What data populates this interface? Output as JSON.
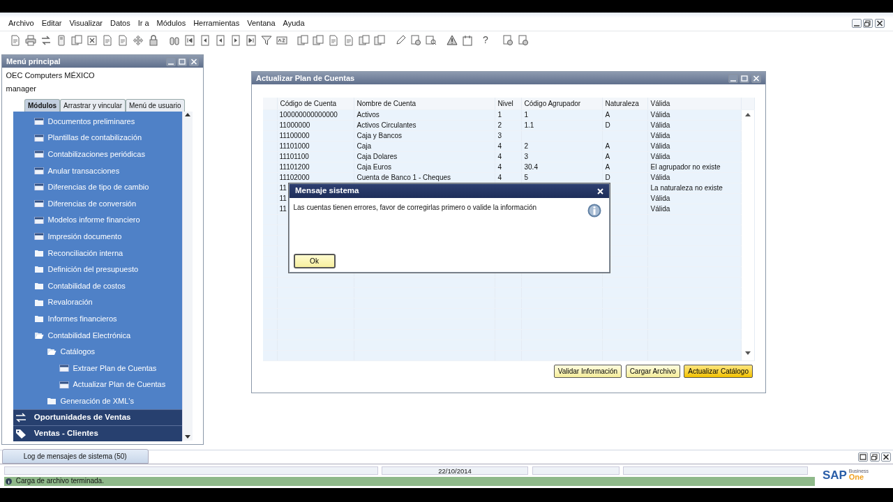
{
  "menu_bar": [
    "Archivo",
    "Editar",
    "Visualizar",
    "Datos",
    "Ir a",
    "Módulos",
    "Herramientas",
    "Ventana",
    "Ayuda"
  ],
  "toolbar": {
    "help_label": "?"
  },
  "main_menu": {
    "title": "Menú principal",
    "company": "OEC Computers MÉXICO",
    "user": "manager",
    "tabs": [
      {
        "label": "Módulos",
        "selected": true
      },
      {
        "label": "Arrastrar y vincular",
        "selected": false
      },
      {
        "label": "Menú de usuario",
        "selected": false
      }
    ],
    "items": [
      {
        "label": "Documentos preliminares",
        "kind": "form"
      },
      {
        "label": "Plantillas de contabilización",
        "kind": "form"
      },
      {
        "label": "Contabilizaciones periódicas",
        "kind": "form"
      },
      {
        "label": "Anular transacciones",
        "kind": "form"
      },
      {
        "label": "Diferencias de tipo de cambio",
        "kind": "form"
      },
      {
        "label": "Diferencias de conversión",
        "kind": "form"
      },
      {
        "label": "Modelos informe financiero",
        "kind": "form"
      },
      {
        "label": "Impresión documento",
        "kind": "form"
      },
      {
        "label": "Reconciliación interna",
        "kind": "folder",
        "expanded": false
      },
      {
        "label": "Definición del presupuesto",
        "kind": "folder",
        "expanded": false
      },
      {
        "label": "Contabilidad de costos",
        "kind": "folder",
        "expanded": false
      },
      {
        "label": "Revaloración",
        "kind": "folder",
        "expanded": false
      },
      {
        "label": "Informes financieros",
        "kind": "folder",
        "expanded": false
      },
      {
        "label": "Contabilidad Electrónica",
        "kind": "folder",
        "expanded": true,
        "children": [
          {
            "label": "Catálogos",
            "kind": "folder",
            "expanded": true,
            "children": [
              {
                "label": "Extraer Plan de Cuentas",
                "kind": "form"
              },
              {
                "label": "Actualizar Plan de Cuentas",
                "kind": "form"
              }
            ]
          },
          {
            "label": "Generación de XML's",
            "kind": "folder",
            "expanded": false
          }
        ]
      }
    ],
    "modules": [
      {
        "label": "Oportunidades de Ventas",
        "kind": "opportunities"
      },
      {
        "label": "Ventas - Clientes",
        "kind": "sales"
      }
    ]
  },
  "window": {
    "title": "Actualizar Plan de Cuentas",
    "table": {
      "columns": [
        "Código de Cuenta",
        "Nombre de Cuenta",
        "Nivel",
        "Código Agrupador",
        "Naturaleza",
        "Válida"
      ],
      "rows": [
        [
          "100000000000000",
          "Activos",
          "1",
          "1",
          "A",
          "Válida"
        ],
        [
          "11000000",
          "Activos Circulantes",
          "2",
          "1.1",
          "D",
          "Válida"
        ],
        [
          "11100000",
          "Caja y Bancos",
          "3",
          null,
          null,
          "Válida"
        ],
        [
          "11101000",
          "Caja",
          "4",
          "2",
          "A",
          "Válida"
        ],
        [
          "11101100",
          "Caja Dolares",
          "4",
          "3",
          "A",
          "Válida"
        ],
        [
          "11101200",
          "Caja Euros",
          "4",
          "30.4",
          "A",
          "El agrupador no existe"
        ],
        [
          "11102000",
          "Cuenta de Banco 1 - Cheques",
          "4",
          "5",
          "D",
          "Válida"
        ],
        [
          "11",
          null,
          null,
          null,
          null,
          "La naturaleza no existe"
        ],
        [
          "11",
          null,
          null,
          null,
          null,
          "Válida"
        ],
        [
          "11",
          null,
          null,
          null,
          null,
          "Válida"
        ]
      ]
    },
    "buttons": [
      {
        "label": "Validar Información",
        "default": false
      },
      {
        "label": "Cargar Archivo",
        "default": false
      },
      {
        "label": "Actualizar Catálogo",
        "default": true
      }
    ]
  },
  "dialog": {
    "title": "Mensaje sistema",
    "message": "Las cuentas tienen errores, favor de corregirlas primero o valide la información",
    "button": "Ok"
  },
  "status_bar": {
    "log_tab": "Log de mensajes de sistema (50)",
    "date": "22/10/2014",
    "message": "Carga de archivo terminada."
  },
  "logo": {
    "brand": "SAP",
    "line_1": "Business",
    "line_2": "One"
  }
}
